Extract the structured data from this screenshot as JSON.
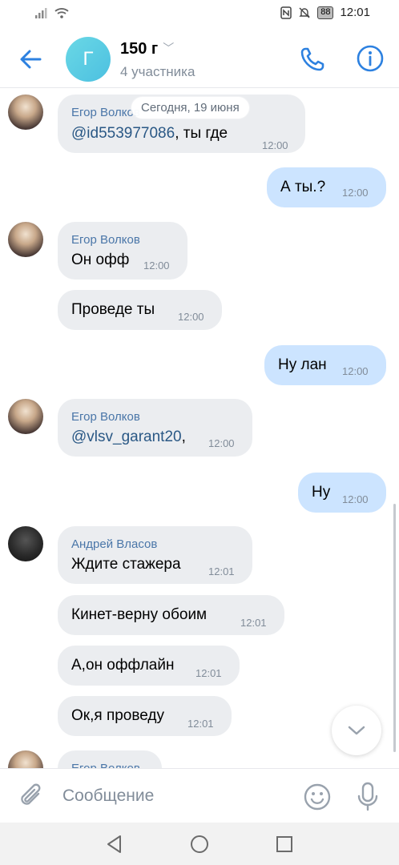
{
  "status_bar": {
    "time": "12:01",
    "battery": "88",
    "icons": [
      "signal-icon",
      "wifi-icon",
      "nfc-icon",
      "mute-icon",
      "battery-icon"
    ]
  },
  "header": {
    "avatar_letter": "Г",
    "title": "150 г",
    "subtitle": "4 участника",
    "icons": [
      "back-arrow-icon",
      "phone-icon",
      "info-icon"
    ]
  },
  "feed": {
    "date_label": "Сегодня, 19 июня",
    "messages": [
      {
        "sender": "Егор Волков",
        "mention": "@id553977086",
        "text": ", ты где",
        "time": "12:00",
        "out": false
      },
      {
        "text": "А ты.?",
        "time": "12:00",
        "out": true
      },
      {
        "sender": "Егор Волков",
        "text": "Он офф",
        "time": "12:00",
        "out": false
      },
      {
        "text": "Проведе ты",
        "time": "12:00",
        "out": false
      },
      {
        "text": "Ну лан",
        "time": "12:00",
        "out": true
      },
      {
        "sender": "Егор Волков",
        "mention": "@vlsv_garant20",
        "text": ",",
        "time": "12:00",
        "out": false
      },
      {
        "text": "Ну",
        "time": "12:00",
        "out": true
      },
      {
        "sender": "Андрей Власов",
        "text": "Ждите стажера",
        "time": "12:01",
        "out": false
      },
      {
        "text": "Кинет-верну обоим",
        "time": "12:01",
        "out": false
      },
      {
        "text": "А,он оффлайн",
        "time": "12:01",
        "out": false
      },
      {
        "text": "Ок,я проведу",
        "time": "12:01",
        "out": false
      },
      {
        "sender": "Егор Волков",
        "out": false
      }
    ]
  },
  "composer": {
    "placeholder": "Сообщение",
    "icons": [
      "paperclip-icon",
      "emoji-icon",
      "microphone-icon"
    ]
  },
  "navbar": {
    "icons": [
      "nav-back-icon",
      "nav-home-icon",
      "nav-recents-icon"
    ]
  },
  "colors": {
    "accent": "#2d81e0",
    "incoming_bubble": "#ebedf0",
    "outgoing_bubble": "#cce4ff",
    "sender_name": "#4a76a8"
  }
}
